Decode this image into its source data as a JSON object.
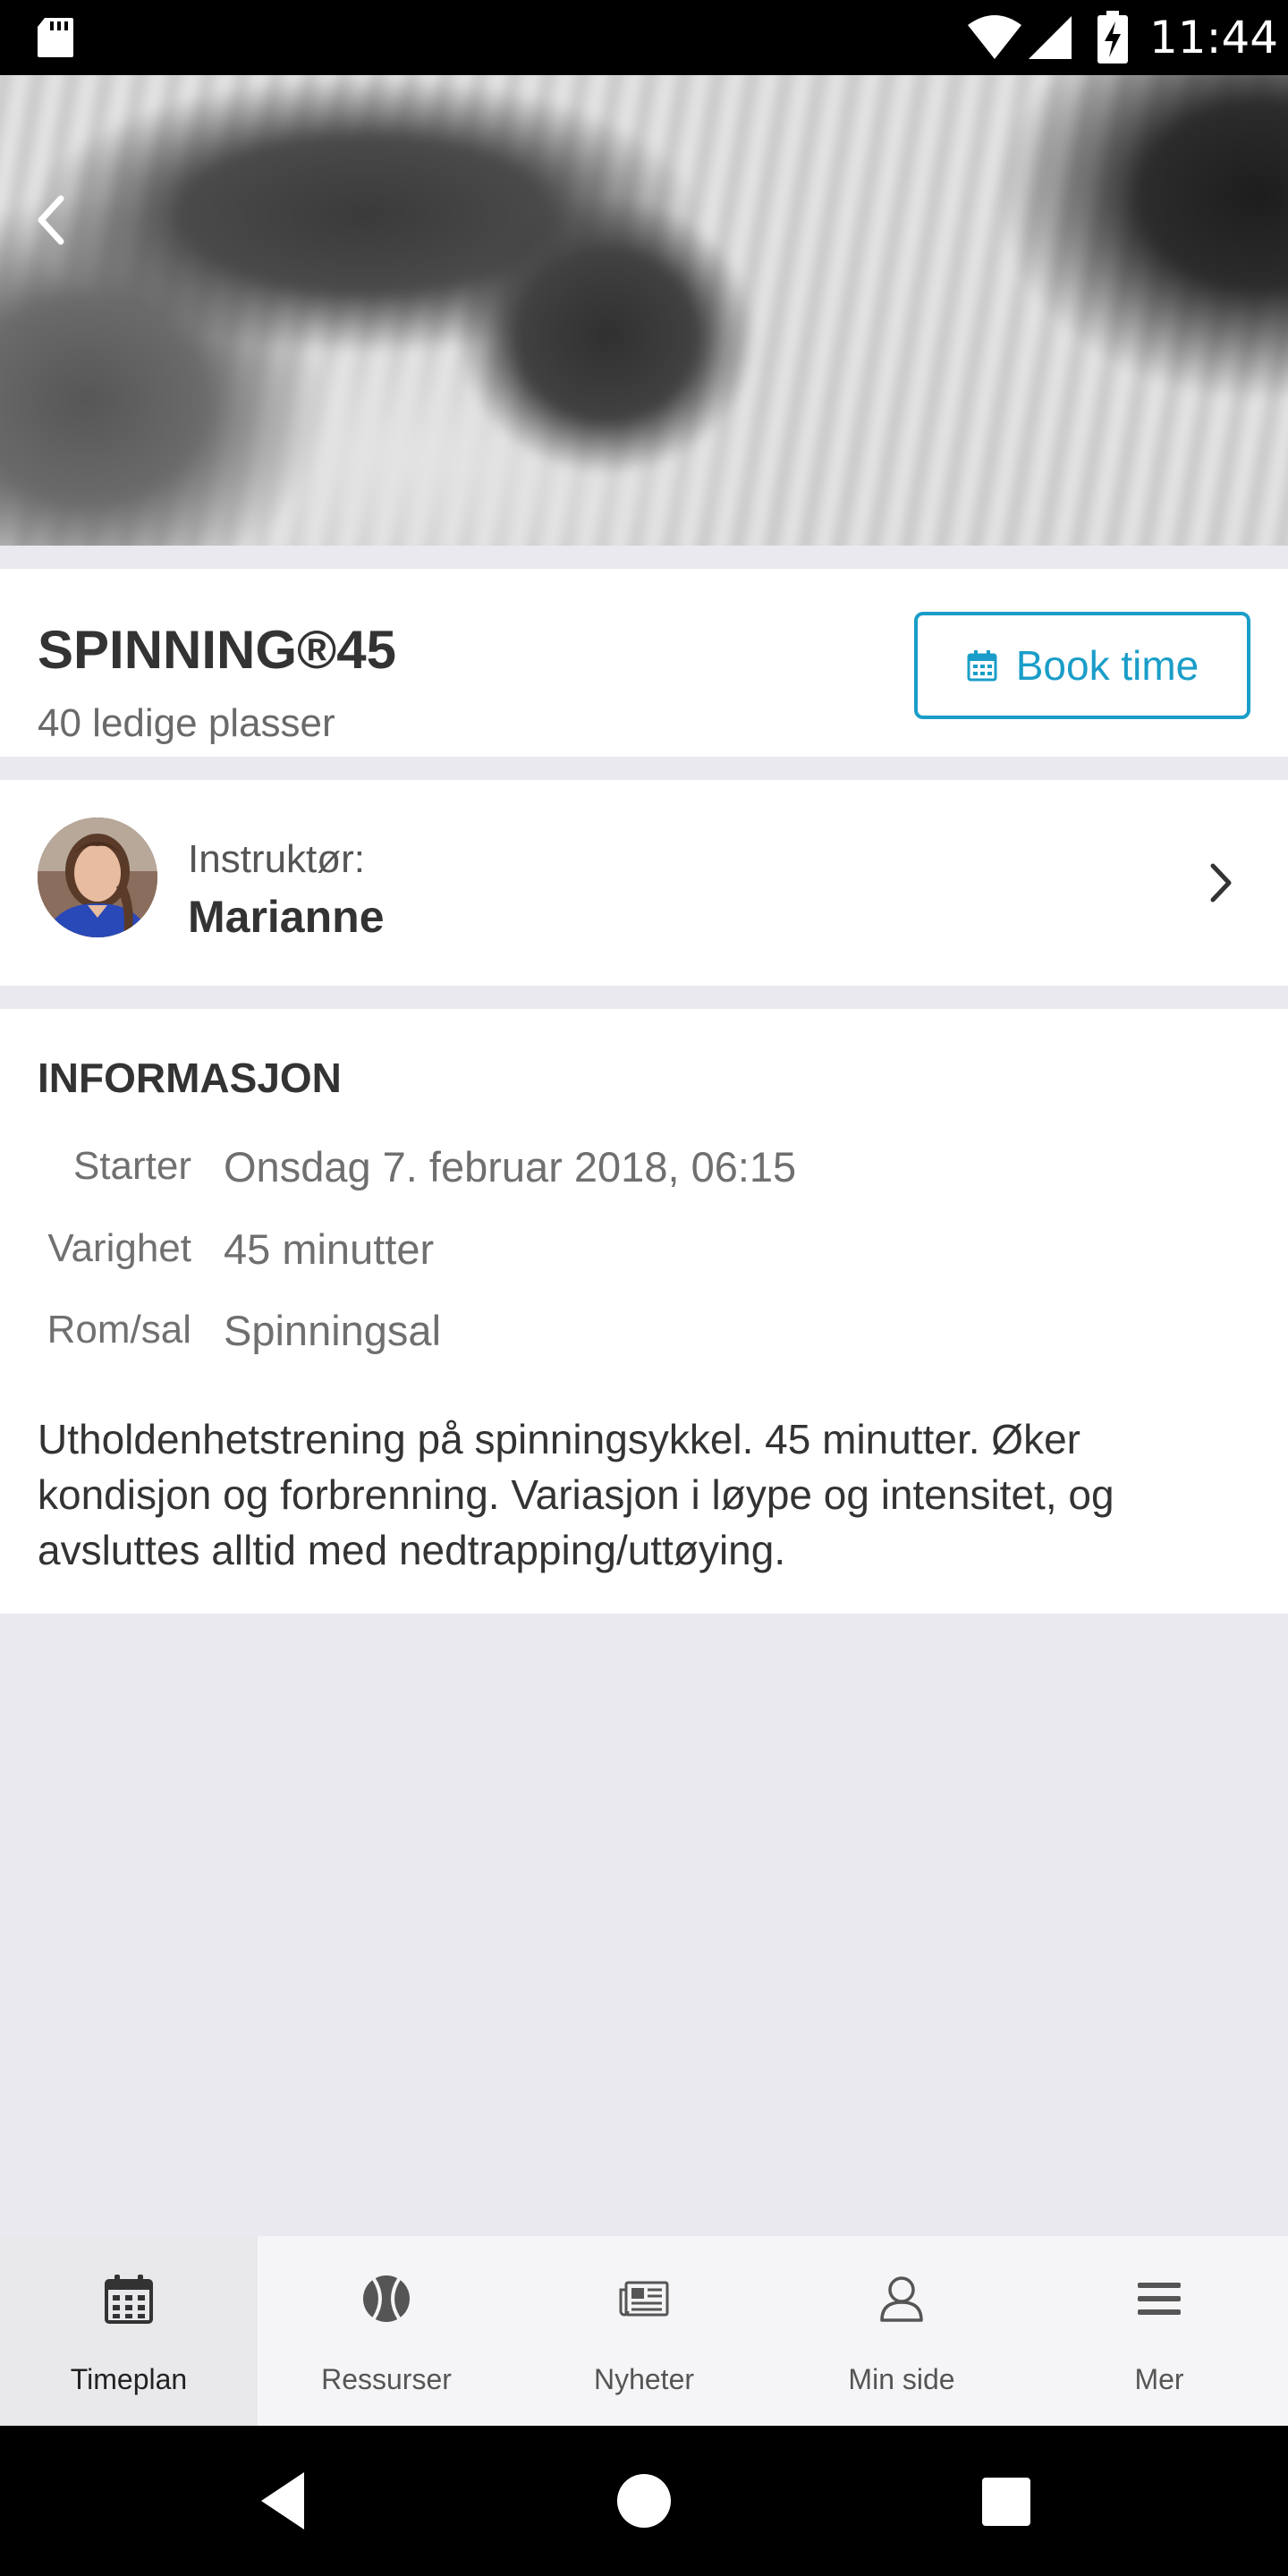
{
  "status_bar": {
    "time": "11:44"
  },
  "header": {
    "back_icon": "chevron-left-icon"
  },
  "class": {
    "title": "SPINNING®45",
    "availability": "40 ledige plasser",
    "book_label": "Book time",
    "accent_color": "#1a9dc8"
  },
  "instructor": {
    "label": "Instruktør:",
    "name": "Marianne"
  },
  "info": {
    "section_title": "INFORMASJON",
    "rows": [
      {
        "key": "Starter",
        "value": "Onsdag 7. februar 2018, 06:15"
      },
      {
        "key": "Varighet",
        "value": "45 minutter"
      },
      {
        "key": "Rom/sal",
        "value": "Spinningsal"
      }
    ],
    "description": "Utholdenhetstrening på spinningsykkel. 45 minutter. Øker kondisjon og forbrenning. Variasjon i løype og intensitet, og avsluttes alltid med nedtrapping/uttøying."
  },
  "tabs": [
    {
      "label": "Timeplan",
      "icon": "calendar-icon",
      "active": true
    },
    {
      "label": "Ressurser",
      "icon": "ball-icon",
      "active": false
    },
    {
      "label": "Nyheter",
      "icon": "newspaper-icon",
      "active": false
    },
    {
      "label": "Min side",
      "icon": "user-icon",
      "active": false
    },
    {
      "label": "Mer",
      "icon": "menu-icon",
      "active": false
    }
  ]
}
